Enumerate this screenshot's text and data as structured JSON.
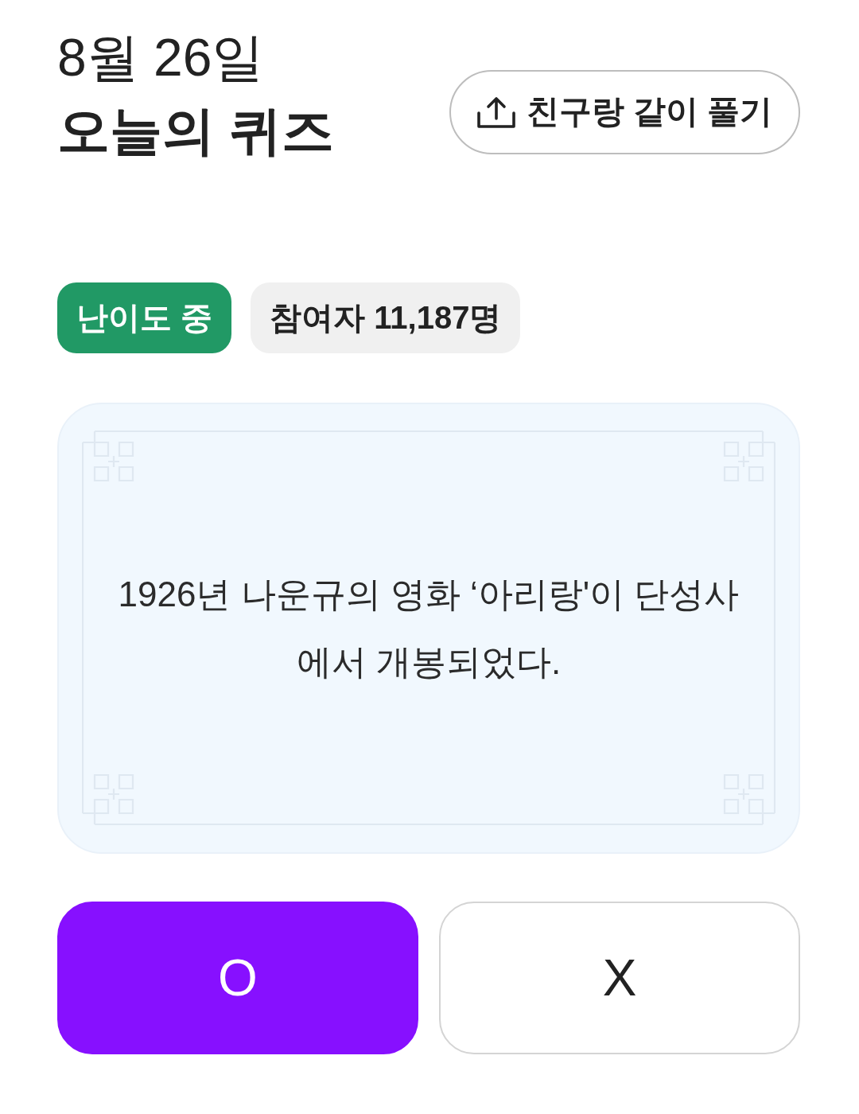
{
  "header": {
    "date": "8월 26일",
    "title": "오늘의 퀴즈",
    "share_button": {
      "label": "친구랑 같이 풀기"
    }
  },
  "badges": [
    {
      "kind": "difficulty",
      "text": "난이도 중"
    },
    {
      "kind": "participants",
      "text": "참여자 11,187명"
    }
  ],
  "question": {
    "text": "1926년 나운규의 영화 ‘아리랑'이 단성사에서 개봉되었다."
  },
  "answers": [
    {
      "label": "O",
      "selected": true
    },
    {
      "label": "X",
      "selected": false
    }
  ]
}
